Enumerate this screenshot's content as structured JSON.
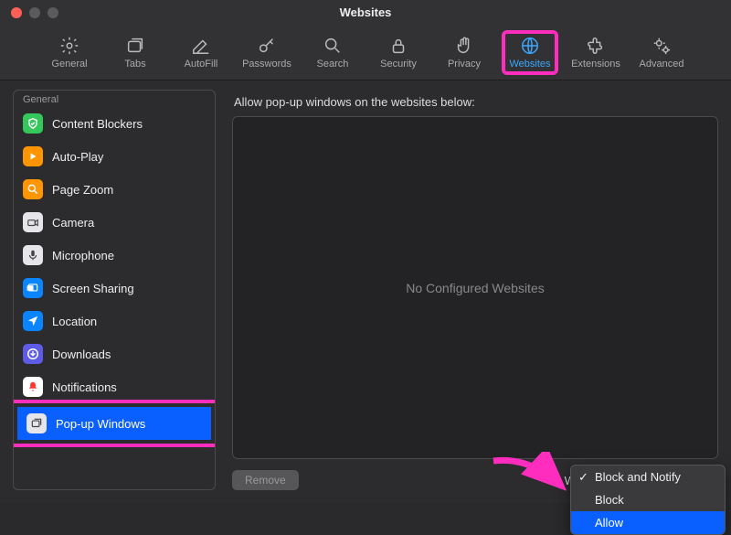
{
  "window": {
    "title": "Websites"
  },
  "toolbar": {
    "items": [
      {
        "label": "General"
      },
      {
        "label": "Tabs"
      },
      {
        "label": "AutoFill"
      },
      {
        "label": "Passwords"
      },
      {
        "label": "Search"
      },
      {
        "label": "Security"
      },
      {
        "label": "Privacy"
      },
      {
        "label": "Websites"
      },
      {
        "label": "Extensions"
      },
      {
        "label": "Advanced"
      }
    ]
  },
  "sidebar": {
    "header": "General",
    "items": [
      {
        "label": "Content Blockers"
      },
      {
        "label": "Auto-Play"
      },
      {
        "label": "Page Zoom"
      },
      {
        "label": "Camera"
      },
      {
        "label": "Microphone"
      },
      {
        "label": "Screen Sharing"
      },
      {
        "label": "Location"
      },
      {
        "label": "Downloads"
      },
      {
        "label": "Notifications"
      },
      {
        "label": "Pop-up Windows"
      }
    ]
  },
  "main": {
    "heading": "Allow pop-up windows on the websites below:",
    "empty_text": "No Configured Websites",
    "remove_label": "Remove",
    "other_label": "When visiting other websites:"
  },
  "dropdown": {
    "items": [
      {
        "label": "Block and Notify"
      },
      {
        "label": "Block"
      },
      {
        "label": "Allow"
      }
    ]
  },
  "help": {
    "glyph": "?"
  }
}
